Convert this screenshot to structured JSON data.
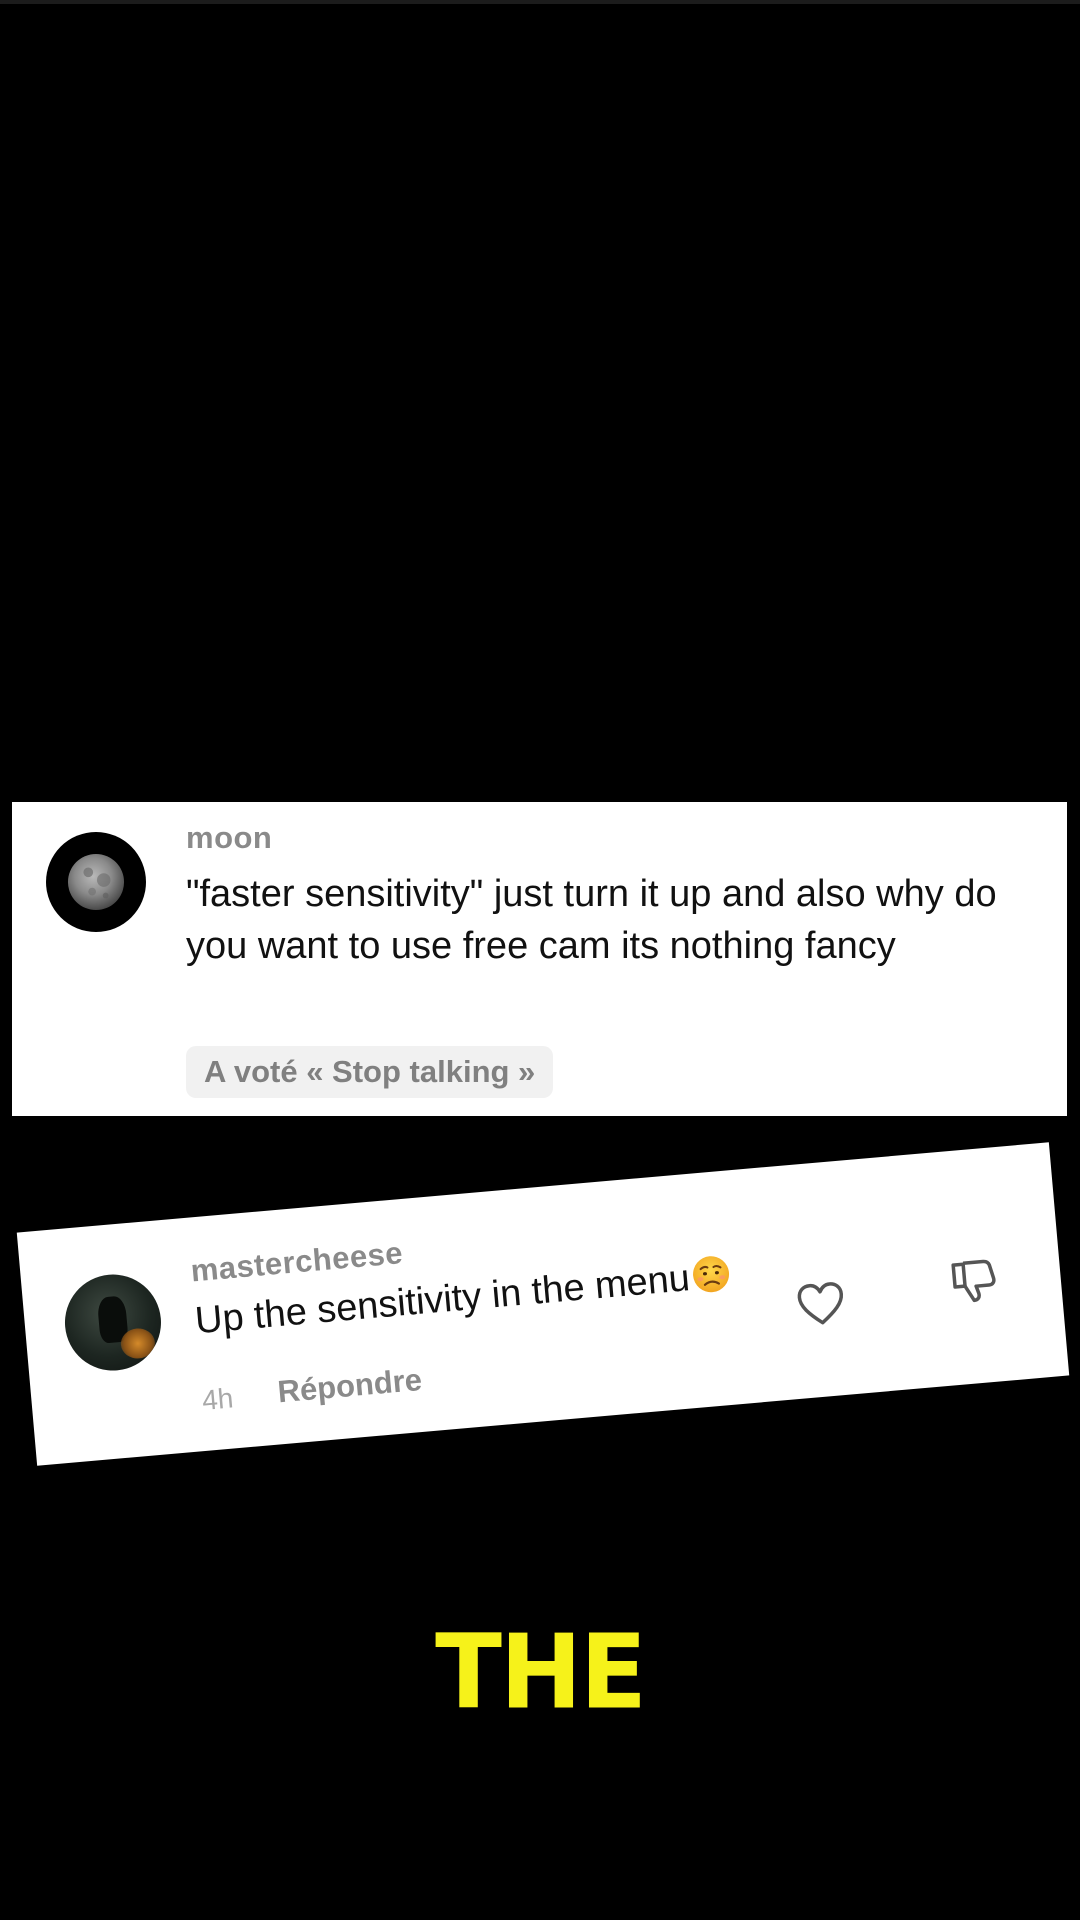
{
  "comments": [
    {
      "username": "moon",
      "text": "\"faster sensitivity\" just turn it up and also why do you want to use free cam its nothing fancy",
      "vote": "A voté « Stop talking »",
      "avatar_icon": "moon-icon"
    },
    {
      "username": "mastercheese",
      "text": "Up the sensitivity in the menu",
      "emoji": "worried-face-emoji",
      "time": "4h",
      "reply_label": "Répondre",
      "like_icon": "heart-icon",
      "dislike_icon": "thumbs-down-icon"
    }
  ],
  "caption": "THE",
  "colors": {
    "background": "#000000",
    "card": "#ffffff",
    "caption": "#f6f21a",
    "muted_text": "#8a8a8a"
  }
}
